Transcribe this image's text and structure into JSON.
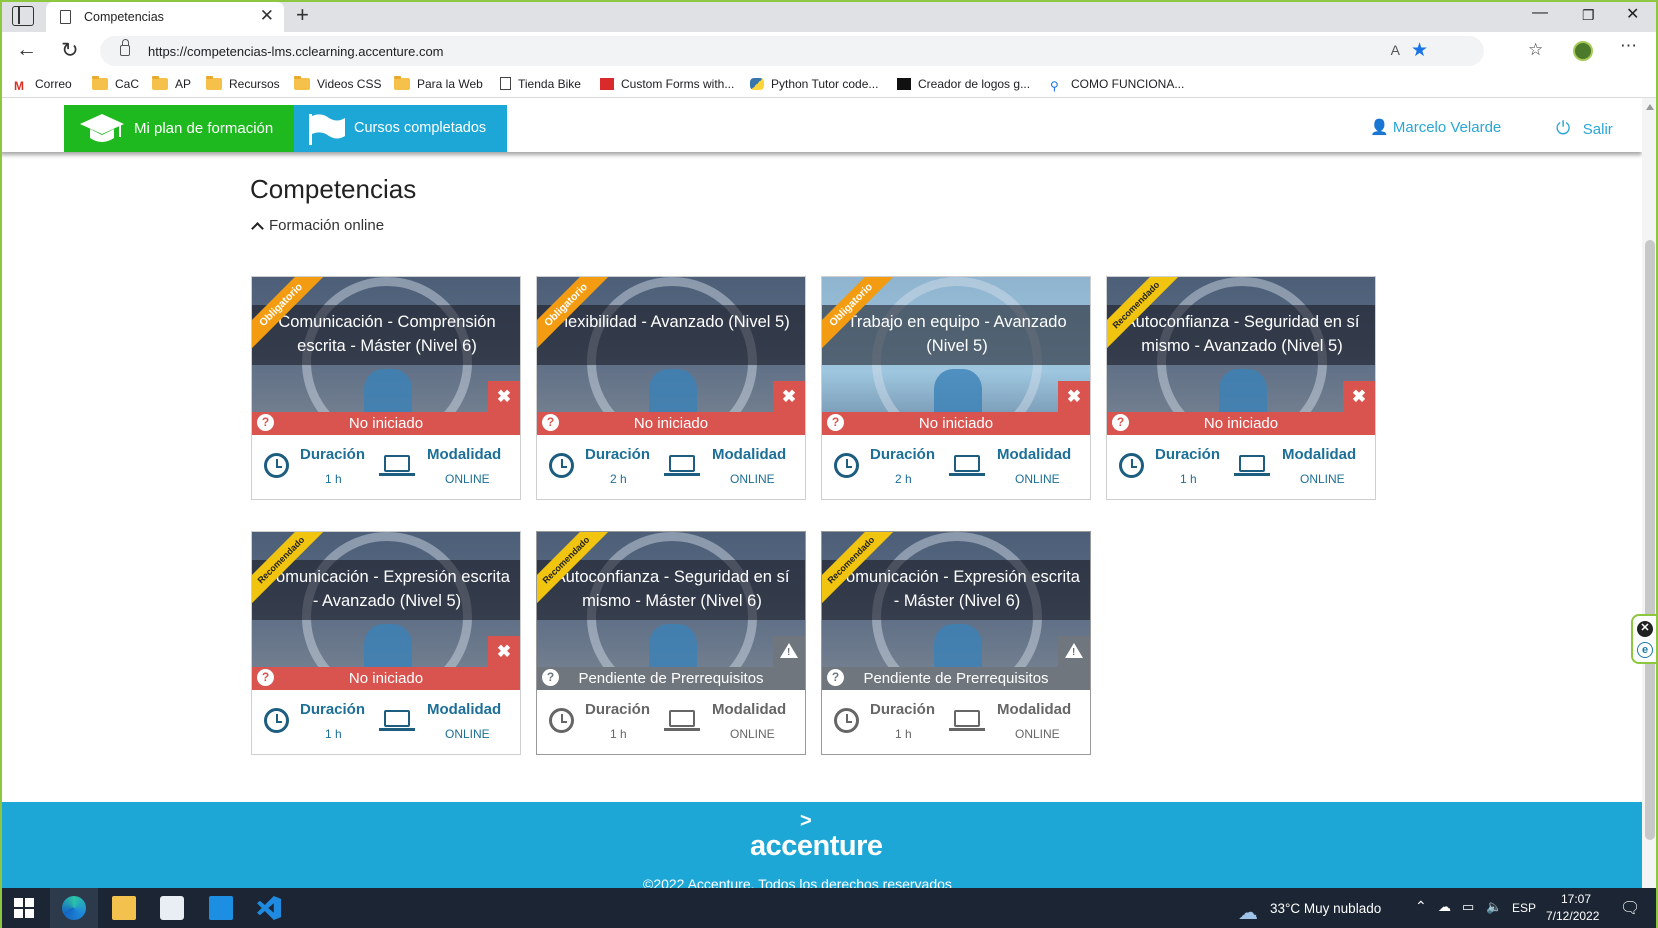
{
  "browser": {
    "tab_title": "Competencias",
    "url": "https://competencias-lms.cclearning.accenture.com",
    "read_aloud": "A",
    "bookmarks": [
      "Correo",
      "CaC",
      "AP",
      "Recursos",
      "Videos CSS",
      "Para la Web",
      "Tienda Bike",
      "Custom Forms with...",
      "Python Tutor code...",
      "Creador de logos g...",
      "COMO FUNCIONA..."
    ]
  },
  "nav": {
    "plan": "Mi plan de formación",
    "completed": "Cursos completados",
    "user": "Marcelo Velarde",
    "exit": "Salir"
  },
  "page": {
    "title": "Competencias",
    "section": "Formación online"
  },
  "labels": {
    "duration": "Duración",
    "modality": "Modalidad"
  },
  "courses": [
    {
      "tag": "Obligatorio",
      "title": "Comunicación - Comprensión escrita - Máster (Nivel 6)",
      "status": "No iniciado",
      "duration": "1 h",
      "modality": "ONLINE"
    },
    {
      "tag": "Obligatorio",
      "title": "Flexibilidad - Avanzado (Nivel 5)",
      "status": "No iniciado",
      "duration": "2 h",
      "modality": "ONLINE"
    },
    {
      "tag": "Obligatorio",
      "title": "Trabajo en equipo - Avanzado (Nivel 5)",
      "status": "No iniciado",
      "duration": "2 h",
      "modality": "ONLINE"
    },
    {
      "tag": "Recomendado",
      "title": "Autoconfianza - Seguridad en sí mismo - Avanzado (Nivel 5)",
      "status": "No iniciado",
      "duration": "1 h",
      "modality": "ONLINE"
    },
    {
      "tag": "Recomendado",
      "title": "Comunicación - Expresión escrita - Avanzado (Nivel 5)",
      "status": "No iniciado",
      "duration": "1 h",
      "modality": "ONLINE"
    },
    {
      "tag": "Recomendado",
      "title": "Autoconfianza - Seguridad en sí mismo - Máster (Nivel 6)",
      "status": "Pendiente de Prerrequisitos",
      "duration": "1 h",
      "modality": "ONLINE"
    },
    {
      "tag": "Recomendado",
      "title": "Comunicación - Expresión escrita - Máster (Nivel 6)",
      "status": "Pendiente de Prerrequisitos",
      "duration": "1 h",
      "modality": "ONLINE"
    }
  ],
  "footer": {
    "logo": "accenture",
    "logo_mark": ">",
    "copyright": "©2022 Accenture. Todos los derechos reservados"
  },
  "taskbar": {
    "weather": "33°C  Muy nublado",
    "lang": "ESP",
    "time": "17:07",
    "date": "7/12/2022"
  },
  "colors": {
    "nav_green": "#1eb81f",
    "nav_blue": "#1da7d6",
    "status_red": "#d9534f",
    "status_grey": "#6f767d",
    "text_blue": "#1d6f97"
  }
}
